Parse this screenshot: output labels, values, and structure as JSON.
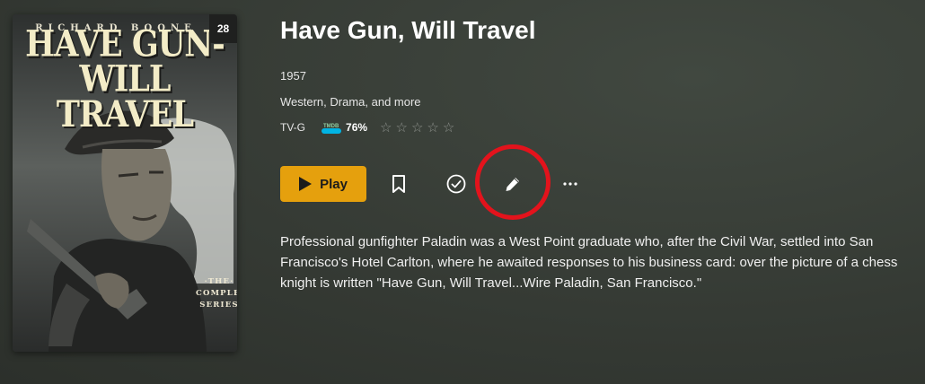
{
  "poster": {
    "actor_name": "RICHARD BOONE",
    "title_line1": "HAVE GUN-",
    "title_line2": "WILL TRAVEL",
    "badge_count": "28",
    "set_line1": "·THE·",
    "set_line2": "COMPLETE",
    "set_line3": "SERIES"
  },
  "details": {
    "title": "Have Gun, Will Travel",
    "year": "1957",
    "genres": "Western, Drama, and more",
    "content_rating": "TV-G",
    "tmdb_logo": "TMDB",
    "tmdb_score": "76%",
    "user_rating_stars": 0,
    "stars_total": 5
  },
  "actions": {
    "play_label": "Play",
    "icons": [
      "bookmark-icon",
      "check-circle-icon",
      "pencil-icon",
      "more-horizontal-icon"
    ]
  },
  "summary": "Professional gunfighter Paladin was a West Point graduate who, after the Civil War, settled into San Francisco's Hotel Carlton, where he awaited responses to his business card: over the picture of a chess knight is written \"Have Gun, Will Travel...Wire Paladin, San Francisco.\"",
  "colors": {
    "accent": "#e5a00d",
    "highlight": "#e3131c",
    "tmdb": "#01b4e4"
  }
}
